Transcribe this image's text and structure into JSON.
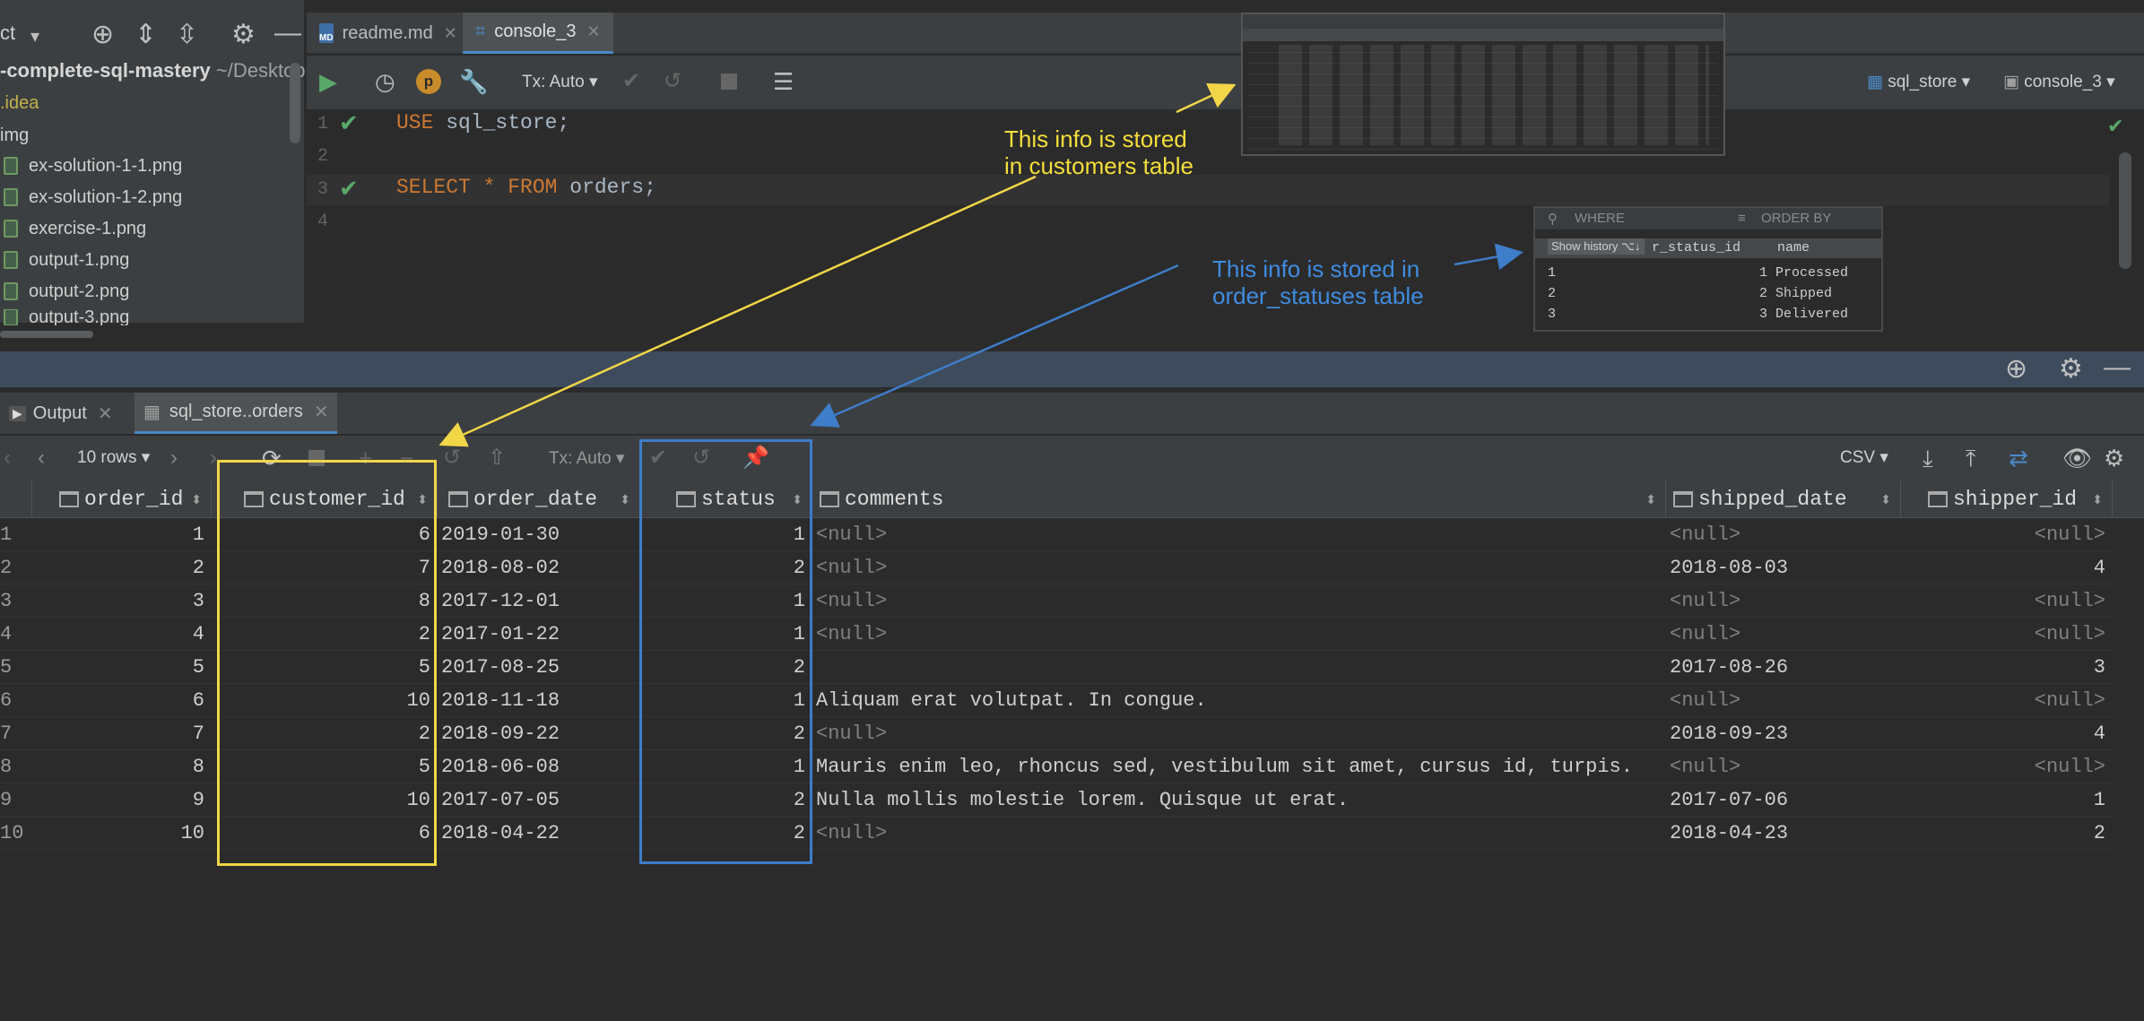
{
  "sidebar": {
    "toolbar_label": "ct",
    "project_name": "-complete-sql-mastery",
    "project_path": "~/Desktop",
    "items": [
      {
        "label": ".idea"
      },
      {
        "label": "img"
      },
      {
        "label": "ex-solution-1-1.png"
      },
      {
        "label": "ex-solution-1-2.png"
      },
      {
        "label": "exercise-1.png"
      },
      {
        "label": "output-1.png"
      },
      {
        "label": "output-2.png"
      },
      {
        "label": "output-3.png"
      }
    ]
  },
  "editor": {
    "tabs": [
      {
        "label": "readme.md"
      },
      {
        "label": "console_3"
      }
    ],
    "tx_mode": "Tx: Auto",
    "datasource": "sql_store",
    "console": "console_3",
    "lines": [
      {
        "num": "1",
        "keyword": "USE",
        "rest": " sql_store;"
      },
      {
        "num": "2"
      },
      {
        "num": "3",
        "keyword": "SELECT",
        "star": " * ",
        "keyword2": "FROM",
        "rest": " orders;"
      },
      {
        "num": "4"
      }
    ]
  },
  "results": {
    "tabs": [
      {
        "label": "Output"
      },
      {
        "label": "sql_store..orders"
      }
    ],
    "rows_label": "10 rows",
    "tx_mode": "Tx: Auto",
    "export_format": "CSV",
    "columns": [
      "order_id",
      "customer_id",
      "order_date",
      "status",
      "comments",
      "shipped_date",
      "shipper_id"
    ],
    "rows": [
      [
        "1",
        "1",
        "6",
        "2019-01-30",
        "1",
        "<null>",
        "<null>",
        "<null>"
      ],
      [
        "2",
        "2",
        "7",
        "2018-08-02",
        "2",
        "<null>",
        "2018-08-03",
        "4"
      ],
      [
        "3",
        "3",
        "8",
        "2017-12-01",
        "1",
        "<null>",
        "<null>",
        "<null>"
      ],
      [
        "4",
        "4",
        "2",
        "2017-01-22",
        "1",
        "<null>",
        "<null>",
        "<null>"
      ],
      [
        "5",
        "5",
        "5",
        "2017-08-25",
        "2",
        "",
        "2017-08-26",
        "3"
      ],
      [
        "6",
        "6",
        "10",
        "2018-11-18",
        "1",
        "Aliquam erat volutpat. In congue.",
        "<null>",
        "<null>"
      ],
      [
        "7",
        "7",
        "2",
        "2018-09-22",
        "2",
        "<null>",
        "2018-09-23",
        "4"
      ],
      [
        "8",
        "8",
        "5",
        "2018-06-08",
        "1",
        "Mauris enim leo, rhoncus sed, vestibulum sit amet, cursus id, turpis.",
        "<null>",
        "<null>"
      ],
      [
        "9",
        "9",
        "10",
        "2017-07-05",
        "2",
        "Nulla mollis molestie lorem. Quisque ut erat.",
        "2017-07-06",
        "1"
      ],
      [
        "10",
        "10",
        "6",
        "2018-04-22",
        "2",
        "<null>",
        "2018-04-23",
        "2"
      ]
    ]
  },
  "annotations": {
    "customers_line1": "This info is stored",
    "customers_line2": "in customers table",
    "statuses_line1": "This info is stored in",
    "statuses_line2": "order_statuses table"
  },
  "statuses_popup": {
    "where_label": "WHERE",
    "order_by_label": "ORDER BY",
    "show_history": "Show history",
    "shortcut": "⌥↓",
    "col_id": "r_status_id",
    "col_name": "name",
    "rows": [
      {
        "row": "1",
        "id": "1",
        "name": "Processed"
      },
      {
        "row": "2",
        "id": "2",
        "name": "Shipped"
      },
      {
        "row": "3",
        "id": "3",
        "name": "Delivered"
      }
    ]
  },
  "colors": {
    "customers_highlight": "#f1d648",
    "statuses_highlight": "#3e7dc9",
    "accent": "#4a88c7"
  }
}
